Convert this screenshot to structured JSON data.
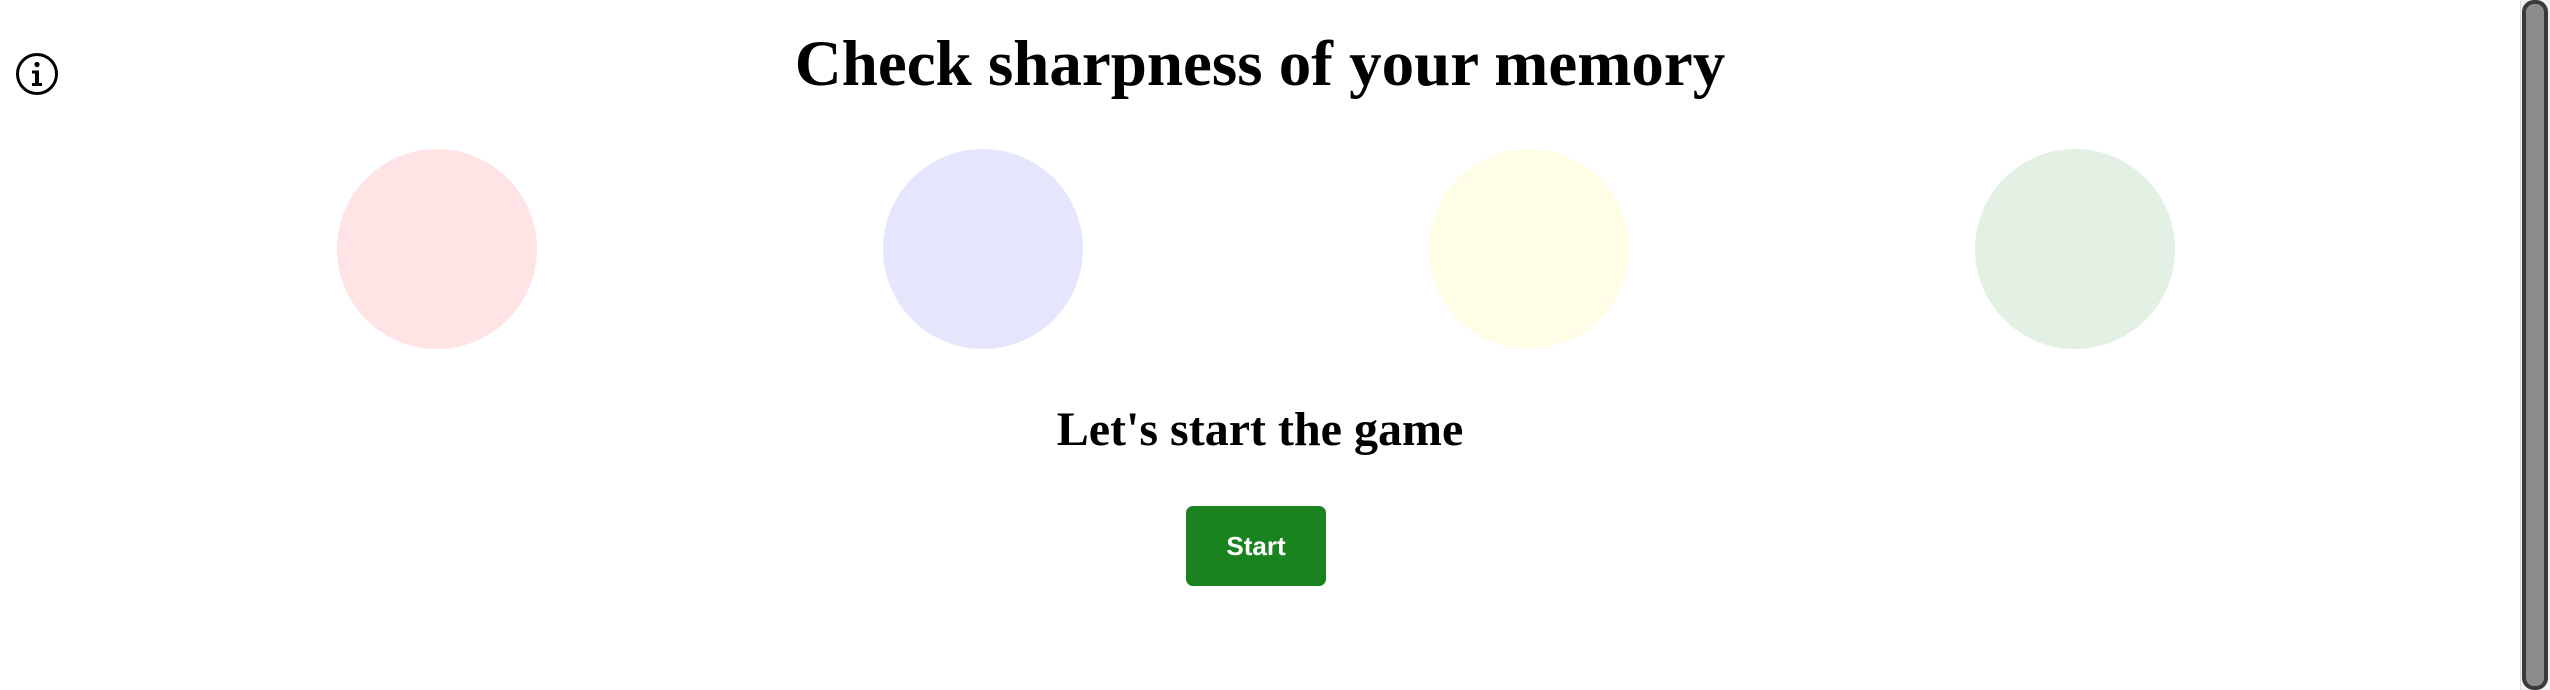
{
  "header": {
    "title": "Check sharpness of your memory",
    "info_icon": "info-circle-icon"
  },
  "game": {
    "circles": [
      {
        "color_name": "red",
        "color": "#ffe4e6"
      },
      {
        "color_name": "blue",
        "color": "#e5e5fd"
      },
      {
        "color_name": "yellow",
        "color": "#fffde6"
      },
      {
        "color_name": "green",
        "color": "#e3f0e4"
      }
    ],
    "message": "Let's start the game",
    "start_label": "Start",
    "start_color": "#1a821e"
  }
}
